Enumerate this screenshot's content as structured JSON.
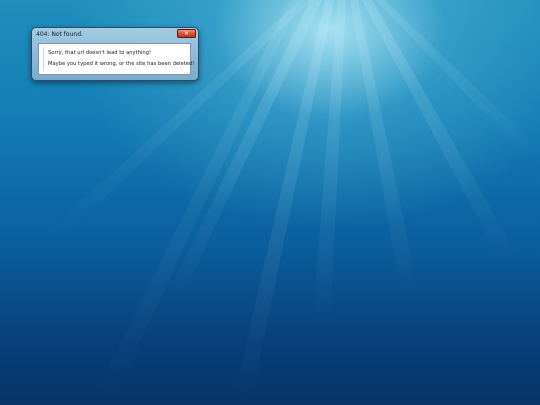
{
  "window": {
    "title": "404: Not found.",
    "close_label": "✕",
    "messages": [
      "Sorry, that url doesn't lead to anything!",
      "Maybe you typed it wrong, or the site has been deleted!"
    ]
  },
  "icons": {
    "close": "close-icon"
  },
  "colors": {
    "desktop_top": "#1f8fbd",
    "desktop_bottom": "#063468",
    "close_button": "#d9532f"
  }
}
